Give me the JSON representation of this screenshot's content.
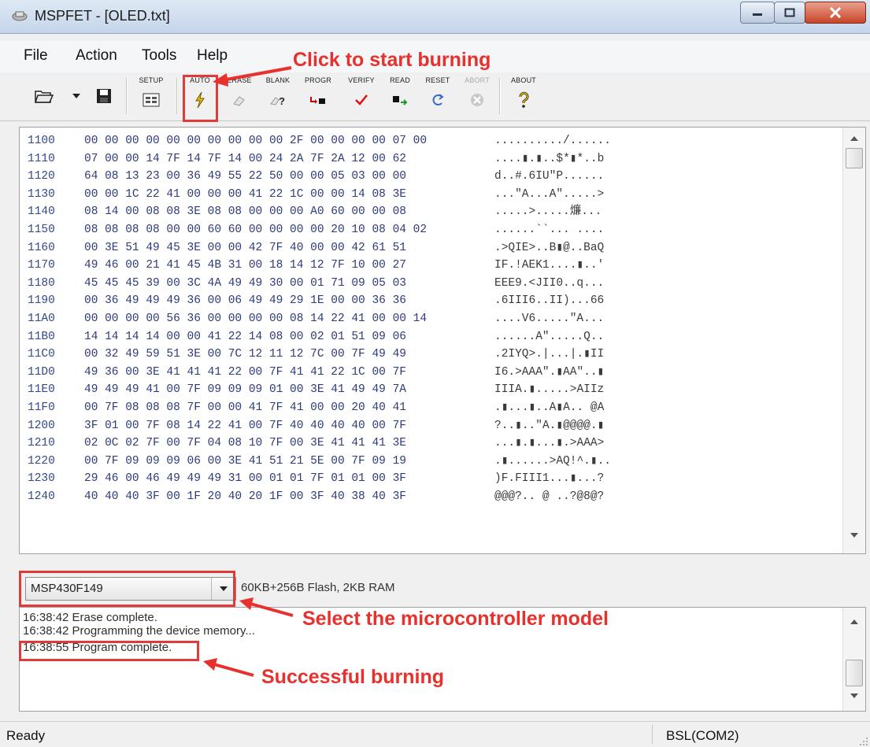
{
  "window": {
    "title": "MSPFET - [OLED.txt]"
  },
  "menu": [
    "File",
    "Action",
    "Tools",
    "Help"
  ],
  "toolbar": {
    "open_icon": "folder-open-icon",
    "save_icon": "floppy-disk-icon",
    "buttons": [
      {
        "label": "SETUP",
        "icon": "setup-icon",
        "enabled": true
      },
      {
        "label": "AUTO",
        "icon": "lightning-icon",
        "enabled": true
      },
      {
        "label": "ERASE",
        "icon": "eraser-icon",
        "enabled": true
      },
      {
        "label": "BLANK",
        "icon": "blank-check-icon",
        "enabled": true
      },
      {
        "label": "PROGR",
        "icon": "program-icon",
        "enabled": true
      },
      {
        "label": "VERIFY",
        "icon": "checkmark-icon",
        "enabled": true
      },
      {
        "label": "READ",
        "icon": "read-icon",
        "enabled": true
      },
      {
        "label": "RESET",
        "icon": "reset-icon",
        "enabled": true
      },
      {
        "label": "ABORT",
        "icon": "abort-icon",
        "enabled": false
      },
      {
        "label": "ABOUT",
        "icon": "question-icon",
        "enabled": true
      }
    ]
  },
  "hex_rows": [
    {
      "addr": "1100",
      "bytes": "00 00 00 00 00 00 00 00 00 00 2F 00 00 00 00 07 00",
      "ascii": "........../......"
    },
    {
      "addr": "1110",
      "bytes": "07 00 00 14 7F 14 7F 14 00 24 2A 7F 2A 12 00 62",
      "ascii": "....▮.▮..$*▮*..b"
    },
    {
      "addr": "1120",
      "bytes": "64 08 13 23 00 36 49 55 22 50 00 00 05 03 00 00",
      "ascii": "d..#.6IU\"P......"
    },
    {
      "addr": "1130",
      "bytes": "00 00 1C 22 41 00 00 00 41 22 1C 00 00 14 08 3E",
      "ascii": "...\"A...A\".....>"
    },
    {
      "addr": "1140",
      "bytes": "08 14 00 08 08 3E 08 08 00 00 00 A0 60 00 00 08",
      "ascii": ".....>.....燫..."
    },
    {
      "addr": "1150",
      "bytes": "08 08 08 08 00 00 60 60 00 00 00 00 20 10 08 04 02",
      "ascii": "......``... ...."
    },
    {
      "addr": "1160",
      "bytes": "00 3E 51 49 45 3E 00 00 42 7F 40 00 00 42 61 51",
      "ascii": ".>QIE>..B▮@..BaQ"
    },
    {
      "addr": "1170",
      "bytes": "49 46 00 21 41 45 4B 31 00 18 14 12 7F 10 00 27",
      "ascii": "IF.!AEK1....▮..'"
    },
    {
      "addr": "1180",
      "bytes": "45 45 45 39 00 3C 4A 49 49 30 00 01 71 09 05 03",
      "ascii": "EEE9.<JII0..q..."
    },
    {
      "addr": "1190",
      "bytes": "00 36 49 49 49 36 00 06 49 49 29 1E 00 00 36 36",
      "ascii": ".6III6..II)...66"
    },
    {
      "addr": "11A0",
      "bytes": "00 00 00 00 56 36 00 00 00 00 08 14 22 41 00 00 14",
      "ascii": "....V6.....\"A..."
    },
    {
      "addr": "11B0",
      "bytes": "14 14 14 14 00 00 41 22 14 08 00 02 01 51 09 06",
      "ascii": "......A\".....Q.."
    },
    {
      "addr": "11C0",
      "bytes": "00 32 49 59 51 3E 00 7C 12 11 12 7C 00 7F 49 49",
      "ascii": ".2IYQ>.|...|.▮II"
    },
    {
      "addr": "11D0",
      "bytes": "49 36 00 3E 41 41 41 22 00 7F 41 41 22 1C 00 7F",
      "ascii": "I6.>AAA\".▮AA\"..▮"
    },
    {
      "addr": "11E0",
      "bytes": "49 49 49 41 00 7F 09 09 09 01 00 3E 41 49 49 7A",
      "ascii": "IIIA.▮.....>AIIz"
    },
    {
      "addr": "11F0",
      "bytes": "00 7F 08 08 08 7F 00 00 41 7F 41 00 00 20 40 41",
      "ascii": ".▮...▮..A▮A.. @A"
    },
    {
      "addr": "1200",
      "bytes": "3F 01 00 7F 08 14 22 41 00 7F 40 40 40 40 00 7F",
      "ascii": "?..▮..\"A.▮@@@@.▮"
    },
    {
      "addr": "1210",
      "bytes": "02 0C 02 7F 00 7F 04 08 10 7F 00 3E 41 41 41 3E",
      "ascii": "...▮.▮...▮.>AAA>"
    },
    {
      "addr": "1220",
      "bytes": "00 7F 09 09 09 06 00 3E 41 51 21 5E 00 7F 09 19",
      "ascii": ".▮......>AQ!^.▮.."
    },
    {
      "addr": "1230",
      "bytes": "29 46 00 46 49 49 49 31 00 01 01 7F 01 01 00 3F",
      "ascii": ")F.FIII1...▮...?"
    },
    {
      "addr": "1240",
      "bytes": "40 40 40 3F 00 1F 20 40 20 1F 00 3F 40 38 40 3F",
      "ascii": "@@@?.. @ ..?@8@?"
    }
  ],
  "device": {
    "selected": "MSP430F149",
    "info": "60KB+256B Flash, 2KB RAM"
  },
  "log": [
    "16:38:42  Erase complete.",
    "16:38:42  Programming the device memory...",
    "16:38:55  Program complete."
  ],
  "status": {
    "left": "Ready",
    "right": "BSL(COM2)"
  },
  "annotations": {
    "start": "Click to start burning",
    "select": "Select the microcontroller model",
    "success": "Successful burning"
  },
  "colors": {
    "annotation": "#e03a3a"
  }
}
